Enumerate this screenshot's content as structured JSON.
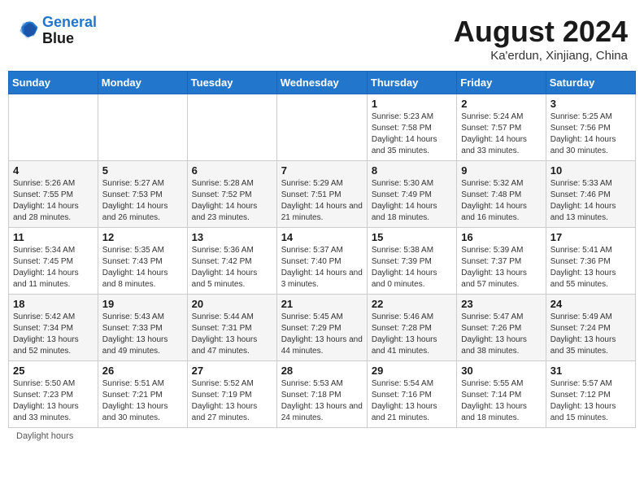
{
  "header": {
    "logo_line1": "General",
    "logo_line2": "Blue",
    "month_title": "August 2024",
    "location": "Ka'erdun, Xinjiang, China"
  },
  "days_of_week": [
    "Sunday",
    "Monday",
    "Tuesday",
    "Wednesday",
    "Thursday",
    "Friday",
    "Saturday"
  ],
  "weeks": [
    [
      {
        "num": "",
        "info": ""
      },
      {
        "num": "",
        "info": ""
      },
      {
        "num": "",
        "info": ""
      },
      {
        "num": "",
        "info": ""
      },
      {
        "num": "1",
        "info": "Sunrise: 5:23 AM\nSunset: 7:58 PM\nDaylight: 14 hours and 35 minutes."
      },
      {
        "num": "2",
        "info": "Sunrise: 5:24 AM\nSunset: 7:57 PM\nDaylight: 14 hours and 33 minutes."
      },
      {
        "num": "3",
        "info": "Sunrise: 5:25 AM\nSunset: 7:56 PM\nDaylight: 14 hours and 30 minutes."
      }
    ],
    [
      {
        "num": "4",
        "info": "Sunrise: 5:26 AM\nSunset: 7:55 PM\nDaylight: 14 hours and 28 minutes."
      },
      {
        "num": "5",
        "info": "Sunrise: 5:27 AM\nSunset: 7:53 PM\nDaylight: 14 hours and 26 minutes."
      },
      {
        "num": "6",
        "info": "Sunrise: 5:28 AM\nSunset: 7:52 PM\nDaylight: 14 hours and 23 minutes."
      },
      {
        "num": "7",
        "info": "Sunrise: 5:29 AM\nSunset: 7:51 PM\nDaylight: 14 hours and 21 minutes."
      },
      {
        "num": "8",
        "info": "Sunrise: 5:30 AM\nSunset: 7:49 PM\nDaylight: 14 hours and 18 minutes."
      },
      {
        "num": "9",
        "info": "Sunrise: 5:32 AM\nSunset: 7:48 PM\nDaylight: 14 hours and 16 minutes."
      },
      {
        "num": "10",
        "info": "Sunrise: 5:33 AM\nSunset: 7:46 PM\nDaylight: 14 hours and 13 minutes."
      }
    ],
    [
      {
        "num": "11",
        "info": "Sunrise: 5:34 AM\nSunset: 7:45 PM\nDaylight: 14 hours and 11 minutes."
      },
      {
        "num": "12",
        "info": "Sunrise: 5:35 AM\nSunset: 7:43 PM\nDaylight: 14 hours and 8 minutes."
      },
      {
        "num": "13",
        "info": "Sunrise: 5:36 AM\nSunset: 7:42 PM\nDaylight: 14 hours and 5 minutes."
      },
      {
        "num": "14",
        "info": "Sunrise: 5:37 AM\nSunset: 7:40 PM\nDaylight: 14 hours and 3 minutes."
      },
      {
        "num": "15",
        "info": "Sunrise: 5:38 AM\nSunset: 7:39 PM\nDaylight: 14 hours and 0 minutes."
      },
      {
        "num": "16",
        "info": "Sunrise: 5:39 AM\nSunset: 7:37 PM\nDaylight: 13 hours and 57 minutes."
      },
      {
        "num": "17",
        "info": "Sunrise: 5:41 AM\nSunset: 7:36 PM\nDaylight: 13 hours and 55 minutes."
      }
    ],
    [
      {
        "num": "18",
        "info": "Sunrise: 5:42 AM\nSunset: 7:34 PM\nDaylight: 13 hours and 52 minutes."
      },
      {
        "num": "19",
        "info": "Sunrise: 5:43 AM\nSunset: 7:33 PM\nDaylight: 13 hours and 49 minutes."
      },
      {
        "num": "20",
        "info": "Sunrise: 5:44 AM\nSunset: 7:31 PM\nDaylight: 13 hours and 47 minutes."
      },
      {
        "num": "21",
        "info": "Sunrise: 5:45 AM\nSunset: 7:29 PM\nDaylight: 13 hours and 44 minutes."
      },
      {
        "num": "22",
        "info": "Sunrise: 5:46 AM\nSunset: 7:28 PM\nDaylight: 13 hours and 41 minutes."
      },
      {
        "num": "23",
        "info": "Sunrise: 5:47 AM\nSunset: 7:26 PM\nDaylight: 13 hours and 38 minutes."
      },
      {
        "num": "24",
        "info": "Sunrise: 5:49 AM\nSunset: 7:24 PM\nDaylight: 13 hours and 35 minutes."
      }
    ],
    [
      {
        "num": "25",
        "info": "Sunrise: 5:50 AM\nSunset: 7:23 PM\nDaylight: 13 hours and 33 minutes."
      },
      {
        "num": "26",
        "info": "Sunrise: 5:51 AM\nSunset: 7:21 PM\nDaylight: 13 hours and 30 minutes."
      },
      {
        "num": "27",
        "info": "Sunrise: 5:52 AM\nSunset: 7:19 PM\nDaylight: 13 hours and 27 minutes."
      },
      {
        "num": "28",
        "info": "Sunrise: 5:53 AM\nSunset: 7:18 PM\nDaylight: 13 hours and 24 minutes."
      },
      {
        "num": "29",
        "info": "Sunrise: 5:54 AM\nSunset: 7:16 PM\nDaylight: 13 hours and 21 minutes."
      },
      {
        "num": "30",
        "info": "Sunrise: 5:55 AM\nSunset: 7:14 PM\nDaylight: 13 hours and 18 minutes."
      },
      {
        "num": "31",
        "info": "Sunrise: 5:57 AM\nSunset: 7:12 PM\nDaylight: 13 hours and 15 minutes."
      }
    ]
  ],
  "footer": {
    "note": "Daylight hours"
  }
}
